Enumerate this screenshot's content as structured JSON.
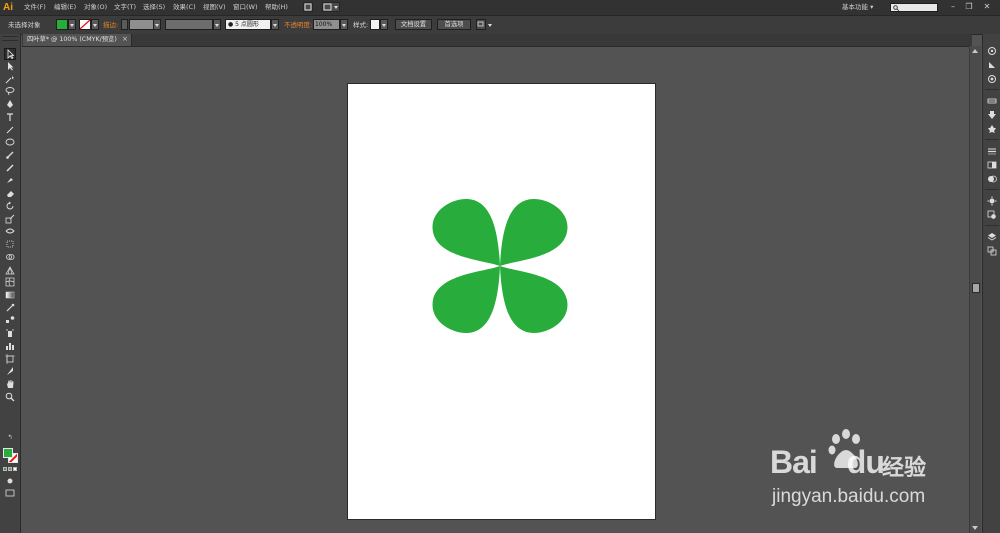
{
  "app": {
    "logo": "Ai"
  },
  "menu": {
    "items": [
      "文件(F)",
      "编辑(E)",
      "对象(O)",
      "文字(T)",
      "选择(S)",
      "效果(C)",
      "视图(V)",
      "窗口(W)",
      "帮助(H)"
    ],
    "workspace": "基本功能",
    "workspace_arrow": "▾"
  },
  "window_controls": {
    "minimize": "–",
    "restore": "❐",
    "close": "✕"
  },
  "controlbar": {
    "selection_status": "未选择对象",
    "fill_color": "#28ad3c",
    "stroke_label": "描边:",
    "brush_value": "5 点圆形",
    "opacity_label": "不透明度:",
    "opacity_value": "100%",
    "style_label": "样式:",
    "doc_setup_button": "文档设置",
    "preferences_button": "首选项"
  },
  "document_tab": {
    "title": "四叶草* @ 100% (CMYK/预览)",
    "close": "×"
  },
  "artwork": {
    "shape": "four-leaf-clover",
    "color": "#28ad3c"
  },
  "toolbar": {
    "tools": [
      "selection-tool-icon",
      "direct-selection-tool-icon",
      "magic-wand-tool-icon",
      "lasso-tool-icon",
      "pen-tool-icon",
      "type-tool-icon",
      "line-tool-icon",
      "ellipse-tool-icon",
      "paintbrush-tool-icon",
      "pencil-tool-icon",
      "blob-brush-tool-icon",
      "eraser-tool-icon",
      "rotate-tool-icon",
      "scale-tool-icon",
      "width-tool-icon",
      "free-transform-tool-icon",
      "shape-builder-tool-icon",
      "perspective-grid-tool-icon",
      "mesh-tool-icon",
      "gradient-tool-icon",
      "eyedropper-tool-icon",
      "blend-tool-icon",
      "symbol-sprayer-tool-icon",
      "column-graph-tool-icon",
      "artboard-tool-icon",
      "slice-tool-icon",
      "hand-tool-icon",
      "zoom-tool-icon"
    ],
    "fill_color": "#28ad3c",
    "stroke_color": "none"
  },
  "watermark": {
    "logo_text": "Bai",
    "logo_text2": "du",
    "brand": "经验",
    "url": "jingyan.baidu.com"
  }
}
